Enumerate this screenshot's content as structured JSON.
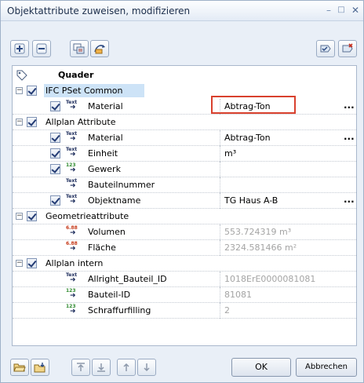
{
  "window": {
    "title": "Objektattribute zuweisen, modifizieren"
  },
  "toolbar": {
    "top_left_icons": [
      "add-icon",
      "remove-icon",
      "copy-attributes-icon",
      "pick-attributes-icon"
    ],
    "top_right_icons": [
      "favorites-icon",
      "delete-favorites-icon"
    ],
    "bottom_icons": [
      "open-folder-icon",
      "save-favorite-icon",
      "move-top-icon",
      "move-bottom-icon",
      "move-up-icon",
      "move-down-icon"
    ]
  },
  "tree": {
    "root_label": "Quader",
    "groups": [
      {
        "label": "IFC PSet Common",
        "rows": [
          {
            "label": "Material",
            "value": "Abtrag-Ton",
            "has_ellipsis": true,
            "highlighted": true
          }
        ]
      },
      {
        "label": "Allplan Attribute",
        "rows": [
          {
            "label": "Material",
            "value": "Abtrag-Ton",
            "has_ellipsis": true
          },
          {
            "label": "Einheit",
            "value": "m³"
          },
          {
            "label": "Gewerk",
            "value": ""
          },
          {
            "label": "Bauteilnummer",
            "value": ""
          },
          {
            "label": "Objektname",
            "value": "TG Haus A-B",
            "has_ellipsis": true
          }
        ]
      },
      {
        "label": "Geometrieattribute",
        "rows": [
          {
            "label": "Volumen",
            "value": "553.724319 m³"
          },
          {
            "label": "Fläche",
            "value": "2324.581466 m²"
          }
        ]
      },
      {
        "label": "Allplan intern",
        "rows": [
          {
            "label": "Allright_Bauteil_ID",
            "value": "1018ErE0000081081"
          },
          {
            "label": "Bauteil-ID",
            "value": "81081"
          },
          {
            "label": "Schraffurfilling",
            "value": "2"
          }
        ]
      }
    ],
    "type_tags": {
      "text": "Text",
      "int": "123",
      "float": "6.88"
    },
    "ellipsis": "...",
    "expander_symbol": "−"
  },
  "buttons": {
    "ok": "OK",
    "cancel": "Abbrechen"
  },
  "colors": {
    "highlight_border": "#d9412e",
    "selection_bg": "#cde3f7"
  }
}
